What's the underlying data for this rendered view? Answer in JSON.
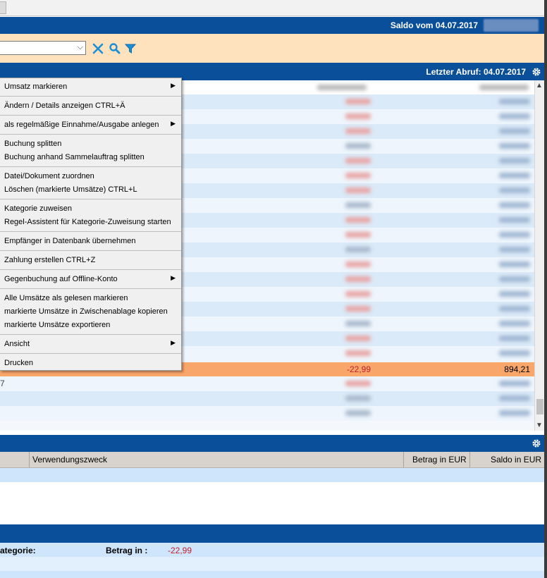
{
  "header": {
    "saldo_label": "Saldo vom 04.07.2017",
    "letzter_abruf_label": "Letzter Abruf: 04.07.2017"
  },
  "selected_row": {
    "amount": "-22,99",
    "saldo": "894,21",
    "partial_text": "7"
  },
  "context_menu": {
    "items": [
      {
        "label": "Umsatz markieren",
        "submenu": true
      },
      {
        "label": "Ändern / Details anzeigen  CTRL+Ä",
        "submenu": false
      },
      {
        "label": "als regelmäßige Einnahme/Ausgabe anlegen",
        "submenu": true
      },
      {
        "label": "Buchung splitten",
        "submenu": false
      },
      {
        "label": "Buchung anhand Sammelauftrag splitten",
        "submenu": false
      },
      {
        "label": "Datei/Dokument zuordnen",
        "submenu": false
      },
      {
        "label": "Löschen (markierte Umsätze)  CTRL+L",
        "submenu": false
      },
      {
        "label": "Kategorie zuweisen",
        "submenu": false
      },
      {
        "label": "Regel-Assistent für Kategorie-Zuweisung starten",
        "submenu": false
      },
      {
        "label": "Empfänger in Datenbank übernehmen",
        "submenu": false
      },
      {
        "label": "Zahlung erstellen    CTRL+Z",
        "submenu": false
      },
      {
        "label": "Gegenbuchung auf Offline-Konto",
        "submenu": true
      },
      {
        "label": "Alle Umsätze als gelesen markieren",
        "submenu": false
      },
      {
        "label": "markierte Umsätze in Zwischenablage kopieren",
        "submenu": false
      },
      {
        "label": "markierte Umsätze exportieren",
        "submenu": false
      },
      {
        "label": "Ansicht",
        "submenu": true
      },
      {
        "label": "Drucken",
        "submenu": false
      }
    ]
  },
  "detail_table": {
    "columns": [
      "Verwendungszweck",
      "Betrag in EUR",
      "Saldo in EUR"
    ]
  },
  "category_section": {
    "kategorie_label": "ategorie:",
    "betrag_label": "Betrag in :",
    "betrag_value": "-22,99"
  },
  "icons": {
    "clear": "close-icon",
    "search": "search-icon",
    "filter": "filter-icon",
    "settings": "gear-icon"
  },
  "colors": {
    "header_blue": "#0a4f9a",
    "filter_bg": "#fde2bd",
    "selected_row": "#f9a66a",
    "negative": "#c0202a",
    "row_alt": "#dbeaf8"
  }
}
